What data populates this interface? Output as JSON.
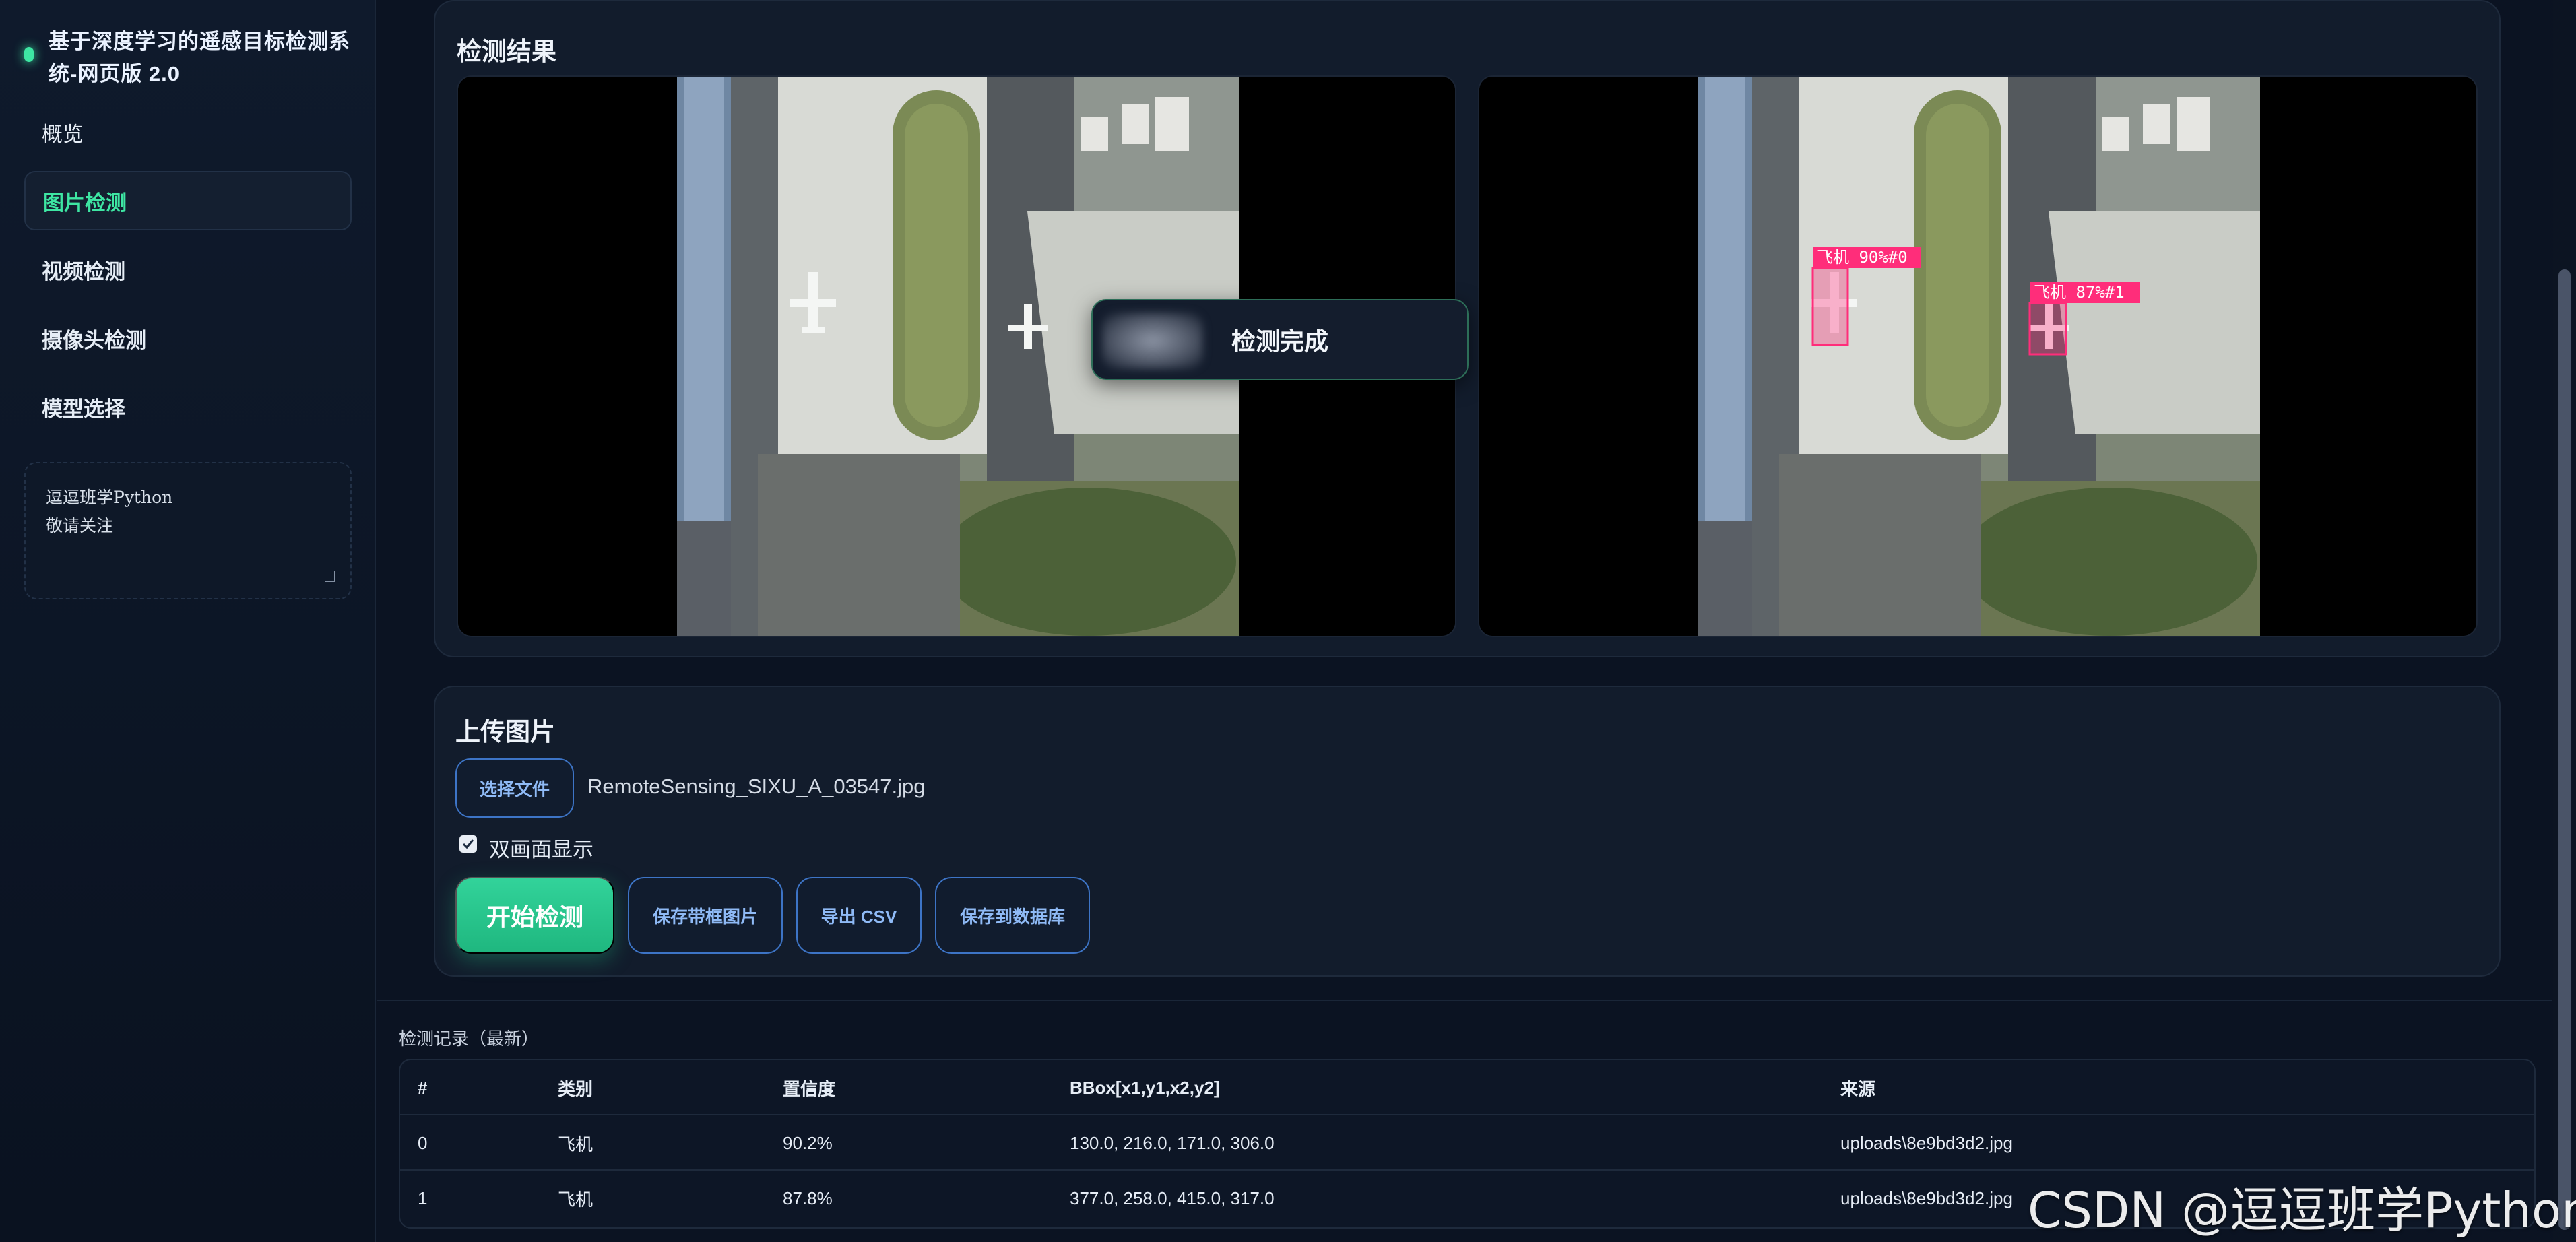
{
  "app": {
    "title": "基于深度学习的遥感目标检测系统-网页版 2.0"
  },
  "sidebar": {
    "items": [
      {
        "label": "概览"
      },
      {
        "label": "图片检测"
      },
      {
        "label": "视频检测"
      },
      {
        "label": "摄像头检测"
      },
      {
        "label": "模型选择"
      }
    ],
    "note": "逗逗班学Python\n敬请关注"
  },
  "result_panel": {
    "title": "检测结果",
    "toast": "检测完成",
    "detections": [
      {
        "label": "飞机 90%#0"
      },
      {
        "label": "飞机 87%#1"
      }
    ]
  },
  "upload_panel": {
    "title": "上传图片",
    "choose_file": "选择文件",
    "file_name": "RemoteSensing_SIXU_A_03547.jpg",
    "dual_view_label": "双画面显示",
    "dual_view_checked": true,
    "start_button": "开始检测",
    "save_image_button": "保存带框图片",
    "export_csv_button": "导出 CSV",
    "save_db_button": "保存到数据库"
  },
  "records": {
    "title": "检测记录（最新）",
    "columns": [
      "#",
      "类别",
      "置信度",
      "BBox[x1,y1,x2,y2]",
      "来源"
    ],
    "rows": [
      [
        "0",
        "飞机",
        "90.2%",
        "130.0, 216.0, 171.0, 306.0",
        "uploads\\8e9bd3d2.jpg"
      ],
      [
        "1",
        "飞机",
        "87.8%",
        "377.0, 258.0, 415.0, 317.0",
        "uploads\\8e9bd3d2.jpg"
      ]
    ]
  },
  "watermark": "CSDN @逗逗班学Python",
  "colors": {
    "accent": "#3ee6a3",
    "button_outline": "#3d74c6",
    "detection_box": "#ff2d7a"
  }
}
